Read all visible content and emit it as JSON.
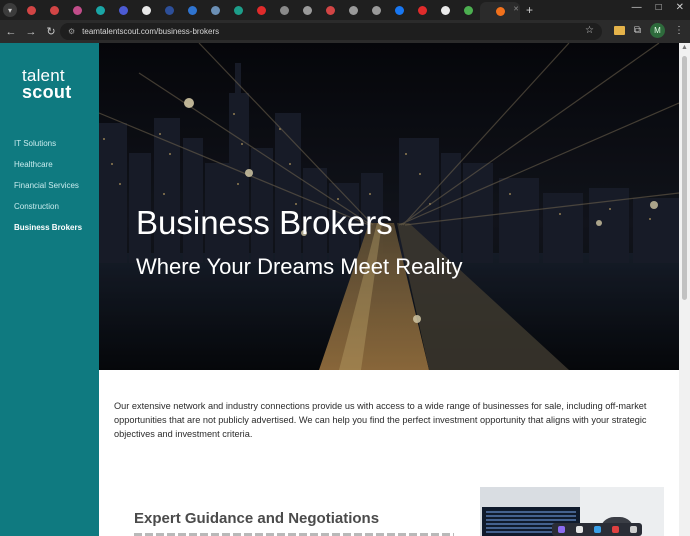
{
  "browser": {
    "tabs": [
      {
        "icon": "chevron-down-icon",
        "color": "#3c3c3c"
      },
      {
        "icon": "a-red-icon",
        "color": "#d24545"
      },
      {
        "icon": "a-red-icon",
        "color": "#d24545"
      },
      {
        "icon": "pinwheel-icon",
        "color": "#c24d8a"
      },
      {
        "icon": "grid-icon",
        "color": "#1aa6a6"
      },
      {
        "icon": "blue-square-icon",
        "color": "#4c5bd4"
      },
      {
        "icon": "f-square-icon",
        "color": "#e8e8e8"
      },
      {
        "icon": "blue-square-icon",
        "color": "#2d4f99"
      },
      {
        "icon": "t-square-icon",
        "color": "#2f74d0"
      },
      {
        "icon": "circle-icon",
        "color": "#6b8fb5"
      },
      {
        "icon": "globe-icon",
        "color": "#1d9e8a"
      },
      {
        "icon": "youtube-icon",
        "color": "#e02b2b"
      },
      {
        "icon": "dots-icon",
        "color": "#8a8a8a"
      },
      {
        "icon": "circle-outline-icon",
        "color": "#9a9a9a"
      },
      {
        "icon": "a-red-icon",
        "color": "#d24545"
      },
      {
        "icon": "circle-outline-icon",
        "color": "#9a9a9a"
      },
      {
        "icon": "gear-icon",
        "color": "#9a9a9a"
      },
      {
        "icon": "facebook-icon",
        "color": "#1877f2"
      },
      {
        "icon": "youtube-icon",
        "color": "#e02b2b"
      },
      {
        "icon": "google-icon",
        "color": "#e9e9e9"
      },
      {
        "icon": "line-icon",
        "color": "#4caf50"
      },
      {
        "icon": "orange-square-icon",
        "color": "#f2711c"
      }
    ],
    "url": "teamtalentscout.com/business-brokers",
    "profile_initial": "M"
  },
  "site": {
    "logo_top": "talent",
    "logo_bottom": "scout",
    "nav": [
      {
        "label": "IT Solutions",
        "active": false
      },
      {
        "label": "Healthcare",
        "active": false
      },
      {
        "label": "Financial Services",
        "active": false
      },
      {
        "label": "Construction",
        "active": false
      },
      {
        "label": "Business Brokers",
        "active": true
      }
    ]
  },
  "hero": {
    "title": "Business Brokers",
    "subtitle": "Where Your Dreams Meet Reality"
  },
  "main": {
    "intro": "Our extensive network and industry connections provide us with access to a wide range of businesses for sale, including off-market opportunities that are not publicly advertised. We can help you find the perfect investment opportunity that aligns with your strategic objectives and investment criteria.",
    "section_heading": "Expert Guidance and Negotiations"
  }
}
